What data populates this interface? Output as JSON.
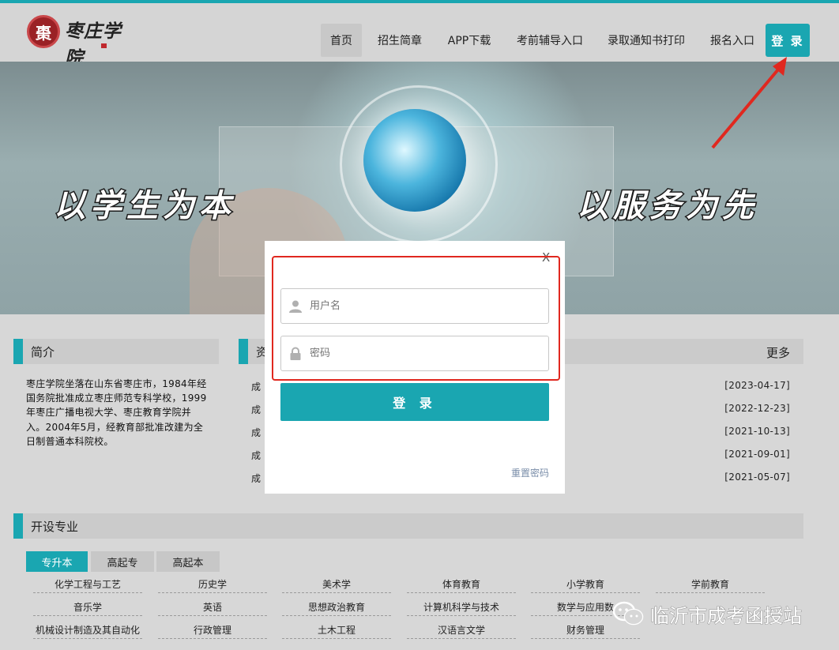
{
  "header": {
    "logo_text": "枣庄学院",
    "logo_seal": "棗",
    "nav": [
      "首页",
      "招生简章",
      "APP下载",
      "考前辅导入口",
      "录取通知书打印",
      "报名入口"
    ],
    "login_label": "登 录"
  },
  "banner": {
    "slogan_left": "以学生为本",
    "slogan_right": "以服务为先"
  },
  "intro": {
    "title": "简介",
    "text": "枣庄学院坐落在山东省枣庄市，1984年经国务院批准成立枣庄师范专科学校，1999年枣庄广播电视大学、枣庄教育学院并入。2004年5月，经教育部批准改建为全日制普通本科院校。"
  },
  "news": {
    "title": "资",
    "more_label": "更多",
    "items": [
      {
        "title": "成",
        "date": "[2023-04-17]"
      },
      {
        "title": "成",
        "date": "[2022-12-23]"
      },
      {
        "title": "成",
        "date": "[2021-10-13]"
      },
      {
        "title": "成",
        "date": "[2021-09-01]"
      },
      {
        "title": "成",
        "date": "[2021-05-07]"
      }
    ]
  },
  "majors": {
    "title": "开设专业",
    "tabs": [
      "专升本",
      "高起专",
      "高起本"
    ],
    "rows": [
      [
        "化学工程与工艺",
        "历史学",
        "美术学",
        "体育教育",
        "小学教育",
        "学前教育"
      ],
      [
        "音乐学",
        "英语",
        "思想政治教育",
        "计算机科学与技术",
        "数学与应用数",
        ""
      ],
      [
        "机械设计制造及其自动化",
        "行政管理",
        "土木工程",
        "汉语言文学",
        "财务管理",
        ""
      ]
    ]
  },
  "modal": {
    "close_label": "X",
    "username_placeholder": "用户名",
    "password_placeholder": "密码",
    "submit_label": "登 录",
    "reset_label": "重置密码"
  },
  "watermark": {
    "text": "临沂市成考函授站"
  },
  "colors": {
    "accent": "#1aa6b1",
    "highlight": "#e0281f"
  }
}
